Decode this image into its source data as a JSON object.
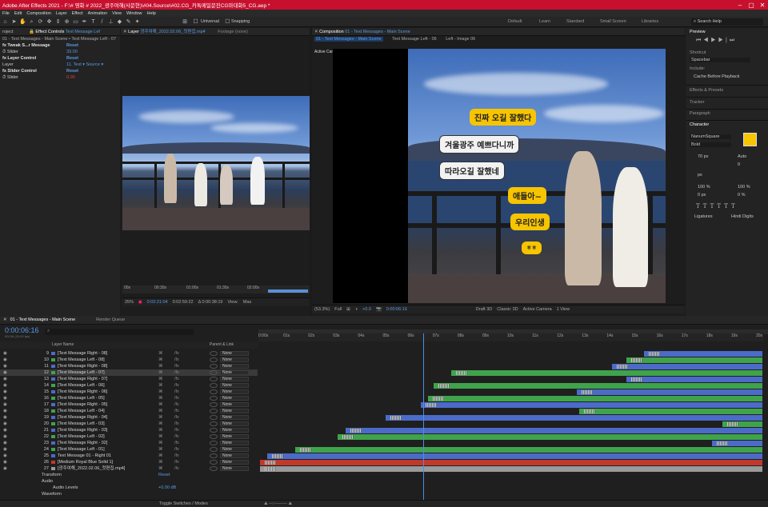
{
  "title": "Adobe After Effects 2021 - F:\\# 영화 # 2022_광주여해(사문현)\\#04.Source\\#02.CG_카톡메일문진CG마대화5_CG.aep *",
  "menu": [
    "File",
    "Edit",
    "Composition",
    "Layer",
    "Effect",
    "Animation",
    "View",
    "Window",
    "Help"
  ],
  "toolbar": {
    "universal": "Universal",
    "snapping": "Snapping"
  },
  "workspaces": [
    "Default",
    "Learn",
    "Standard",
    "Small Screen",
    "Libraries"
  ],
  "search_help": "Search Help",
  "effect_controls": {
    "tab_label": "Effect Controls",
    "tab_layer": "Text Message Lef",
    "project_tab": "roject",
    "breadcrumb": "01 - Text Messages - Main Scene • Text Message Left - 07",
    "rows": [
      {
        "label": "fx  Tweak S...r Message",
        "value": "Reset",
        "type": "fx"
      },
      {
        "label": "   ⏱ Slider",
        "value": "33.00",
        "type": "param"
      },
      {
        "label": "fx  Layer Control",
        "value": "Reset",
        "type": "fx"
      },
      {
        "label": "     Layer",
        "value": "11. Text  ▾   Source  ▾",
        "type": "param"
      },
      {
        "label": "fx  Slider Control",
        "value": "Reset",
        "type": "fx"
      },
      {
        "label": "   ⏱ Slider",
        "value": "0.00",
        "type": "param-red"
      }
    ]
  },
  "layer_viewer": {
    "tab": "Layer",
    "tab_name": "광주여해_2022.02.06_컷편집.mp4",
    "footage_tab": "Footage (none)",
    "ruler": [
      "00s",
      "00:30s",
      "01:00s",
      "01:30s",
      "02:00s"
    ],
    "zoom": "25%",
    "tc1": "0:02:21:04",
    "tc2": "0:02:59:22",
    "tc3": "Δ 0:00:38:19",
    "view": "View:",
    "view_val": "Mas"
  },
  "comp_viewer": {
    "tab": "Composition",
    "tab_name": "01 - Text Messages - Main Scene",
    "crumbs": [
      "01 - Text Messages - Main Scene",
      "Text Message Left - 06",
      "Left - Image 06"
    ],
    "active_camera_label": "Active Camera",
    "zoom": "(53.3%)",
    "quality": "Full",
    "exposure": "+0.0",
    "timecode": "0:00:06:16",
    "renderer": "Draft 3D",
    "classic": "Classic 3D",
    "camera": "Active Camera",
    "view": "1 View"
  },
  "bubbles": [
    {
      "text": "진짜 오길 잘했다",
      "style": "yellow"
    },
    {
      "text": "겨울광주 예쁘다니까",
      "style": "white"
    },
    {
      "text": "따라오길 잘했네",
      "style": "white"
    },
    {
      "text": "애들아~",
      "style": "yellow"
    },
    {
      "text": "우리인생",
      "style": "yellow"
    },
    {
      "text": "ㅎㅎ",
      "style": "yellow"
    }
  ],
  "right_panel": {
    "preview": "Preview",
    "shortcut": "Shortcut",
    "shortcut_val": "Spacebar",
    "include": "Include:",
    "cache": "Cache Before Playback",
    "effects_presets": "Effects & Presets",
    "tracker": "Tracker",
    "paragraph": "Paragraph",
    "character": "Character",
    "font": "NanumSquare",
    "weight": "Bold",
    "font_size": "70 px",
    "leading": "Auto",
    "tracking": "0",
    "px": "px",
    "scale_v": "100 %",
    "scale_h": "100 %",
    "baseline": "0 px",
    "tsume": "0 %",
    "ligatures": "Ligatures",
    "hindi": "Hindi Digits",
    "fill_color": "#f6c400"
  },
  "timeline": {
    "tab": "01 - Text Messages - Main Scene",
    "render_queue": "Render Queue",
    "timecode": "0:00:06:16",
    "subtc": "00136 (24.00 fps)",
    "col_layer_name": "Layer Name",
    "col_parent": "Parent & Link",
    "ruler": [
      "0:00s",
      "01s",
      "02s",
      "03s",
      "04s",
      "05s",
      "06s",
      "07s",
      "08s",
      "09s",
      "10s",
      "11s",
      "12s",
      "13s",
      "14s",
      "15s",
      "16s",
      "17s",
      "18s",
      "19s",
      "20s"
    ],
    "footer": "Toggle Switches / Modes",
    "layers": [
      {
        "num": "9",
        "name": "[Text Message Right - 08]",
        "color": "#4c6bc9",
        "start": 0.765,
        "end": 1.0
      },
      {
        "num": "10",
        "name": "[Text Message Left - 08]",
        "color": "#3fa34b",
        "start": 0.73,
        "end": 1.0
      },
      {
        "num": "11",
        "name": "[Text Message Right - 08]",
        "color": "#4c6bc9",
        "start": 0.7,
        "end": 1.0
      },
      {
        "num": "12",
        "name": "[Text Message Left - 07]",
        "color": "#3fa34b",
        "start": 0.38,
        "end": 1.0
      },
      {
        "num": "13",
        "name": "[Text Message Right - 07]",
        "color": "#4c6bc9",
        "start": 0.73,
        "end": 1.0
      },
      {
        "num": "14",
        "name": "[Text Message Left - 06]",
        "color": "#3fa34b",
        "start": 0.345,
        "end": 1.0
      },
      {
        "num": "15",
        "name": "[Text Message Right - 06]",
        "color": "#4c6bc9",
        "start": 0.63,
        "end": 1.0
      },
      {
        "num": "16",
        "name": "[Text Message Left - 05]",
        "color": "#3fa34b",
        "start": 0.335,
        "end": 1.0
      },
      {
        "num": "17",
        "name": "[Text Message Right - 05]",
        "color": "#4c6bc9",
        "start": 0.32,
        "end": 1.0
      },
      {
        "num": "18",
        "name": "[Text Message Left - 04]",
        "color": "#3fa34b",
        "start": 0.635,
        "end": 1.0
      },
      {
        "num": "19",
        "name": "[Text Message Right - 04]",
        "color": "#4c6bc9",
        "start": 0.25,
        "end": 1.0
      },
      {
        "num": "20",
        "name": "[Text Message Left - 03]",
        "color": "#3fa34b",
        "start": 0.92,
        "end": 1.0
      },
      {
        "num": "21",
        "name": "[Text Message Right - 03]",
        "color": "#4c6bc9",
        "start": 0.17,
        "end": 1.0
      },
      {
        "num": "22",
        "name": "[Text Message Left - 02]",
        "color": "#3fa34b",
        "start": 0.155,
        "end": 1.0
      },
      {
        "num": "23",
        "name": "[Text Message Right - 02]",
        "color": "#4c6bc9",
        "start": 0.9,
        "end": 1.0
      },
      {
        "num": "24",
        "name": "[Text Message Left - 01]",
        "color": "#3fa34b",
        "start": 0.07,
        "end": 1.0
      },
      {
        "num": "25",
        "name": "Text Message 01 - Right 01",
        "color": "#4c6bc9",
        "start": 0.015,
        "end": 1.0
      },
      {
        "num": "26",
        "name": "[Medium Royal Blue Solid 1]",
        "color": "#c0392b",
        "start": 0.0,
        "end": 1.0
      },
      {
        "num": "27",
        "name": "[광주여해_2022.02.06_컷편집.mp4]",
        "color": "#9a9a9a",
        "start": 0.0,
        "end": 1.0
      }
    ],
    "subrows": [
      {
        "label": "Transform",
        "value": "Reset"
      },
      {
        "label": "Audio",
        "value": ""
      },
      {
        "label": "Audio Levels",
        "value": "+0.00 dB"
      },
      {
        "label": "Waveform",
        "value": ""
      }
    ]
  }
}
